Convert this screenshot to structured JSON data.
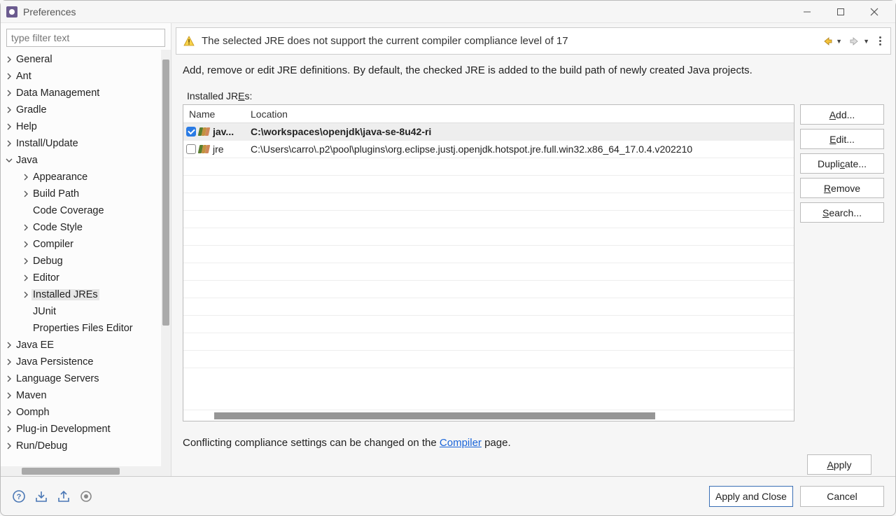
{
  "window": {
    "title": "Preferences"
  },
  "filter": {
    "placeholder": "type filter text"
  },
  "tree": [
    {
      "label": "General",
      "depth": 0,
      "expandable": true,
      "expanded": false
    },
    {
      "label": "Ant",
      "depth": 0,
      "expandable": true,
      "expanded": false
    },
    {
      "label": "Data Management",
      "depth": 0,
      "expandable": true,
      "expanded": false
    },
    {
      "label": "Gradle",
      "depth": 0,
      "expandable": true,
      "expanded": false
    },
    {
      "label": "Help",
      "depth": 0,
      "expandable": true,
      "expanded": false
    },
    {
      "label": "Install/Update",
      "depth": 0,
      "expandable": true,
      "expanded": false
    },
    {
      "label": "Java",
      "depth": 0,
      "expandable": true,
      "expanded": true
    },
    {
      "label": "Appearance",
      "depth": 1,
      "expandable": true,
      "expanded": false
    },
    {
      "label": "Build Path",
      "depth": 1,
      "expandable": true,
      "expanded": false
    },
    {
      "label": "Code Coverage",
      "depth": 1,
      "expandable": false
    },
    {
      "label": "Code Style",
      "depth": 1,
      "expandable": true,
      "expanded": false
    },
    {
      "label": "Compiler",
      "depth": 1,
      "expandable": true,
      "expanded": false
    },
    {
      "label": "Debug",
      "depth": 1,
      "expandable": true,
      "expanded": false
    },
    {
      "label": "Editor",
      "depth": 1,
      "expandable": true,
      "expanded": false
    },
    {
      "label": "Installed JREs",
      "depth": 1,
      "expandable": true,
      "expanded": false,
      "selected": true
    },
    {
      "label": "JUnit",
      "depth": 1,
      "expandable": false
    },
    {
      "label": "Properties Files Editor",
      "depth": 1,
      "expandable": false
    },
    {
      "label": "Java EE",
      "depth": 0,
      "expandable": true,
      "expanded": false
    },
    {
      "label": "Java Persistence",
      "depth": 0,
      "expandable": true,
      "expanded": false
    },
    {
      "label": "Language Servers",
      "depth": 0,
      "expandable": true,
      "expanded": false
    },
    {
      "label": "Maven",
      "depth": 0,
      "expandable": true,
      "expanded": false
    },
    {
      "label": "Oomph",
      "depth": 0,
      "expandable": true,
      "expanded": false
    },
    {
      "label": "Plug-in Development",
      "depth": 0,
      "expandable": true,
      "expanded": false
    },
    {
      "label": "Run/Debug",
      "depth": 0,
      "expandable": true,
      "expanded": false
    }
  ],
  "banner": {
    "text": "The selected JRE does not support the current compiler compliance level of 17"
  },
  "main": {
    "description": "Add, remove or edit JRE definitions. By default, the checked JRE is added to the build path of newly created Java projects.",
    "section_label_prefix": "Installed JR",
    "section_label_mnemonic": "E",
    "section_label_suffix": "s:",
    "columns": {
      "name": "Name",
      "location": "Location"
    },
    "rows": [
      {
        "checked": true,
        "name": "jav...",
        "location": "C:\\workspaces\\openjdk\\java-se-8u42-ri",
        "selected": true
      },
      {
        "checked": false,
        "name": "jre",
        "location": "C:\\Users\\carro\\.p2\\pool\\plugins\\org.eclipse.justj.openjdk.hotspot.jre.full.win32.x86_64_17.0.4.v202210"
      }
    ],
    "buttons": {
      "add": "Add...",
      "edit": "Edit...",
      "duplicate": "Duplicate...",
      "remove": "Remove",
      "search": "Search..."
    },
    "compliance_prefix": "Conflicting compliance settings can be changed on the ",
    "compliance_link": "Compiler",
    "compliance_suffix": " page."
  },
  "footer": {
    "apply": "Apply",
    "apply_close": "Apply and Close",
    "cancel": "Cancel"
  }
}
